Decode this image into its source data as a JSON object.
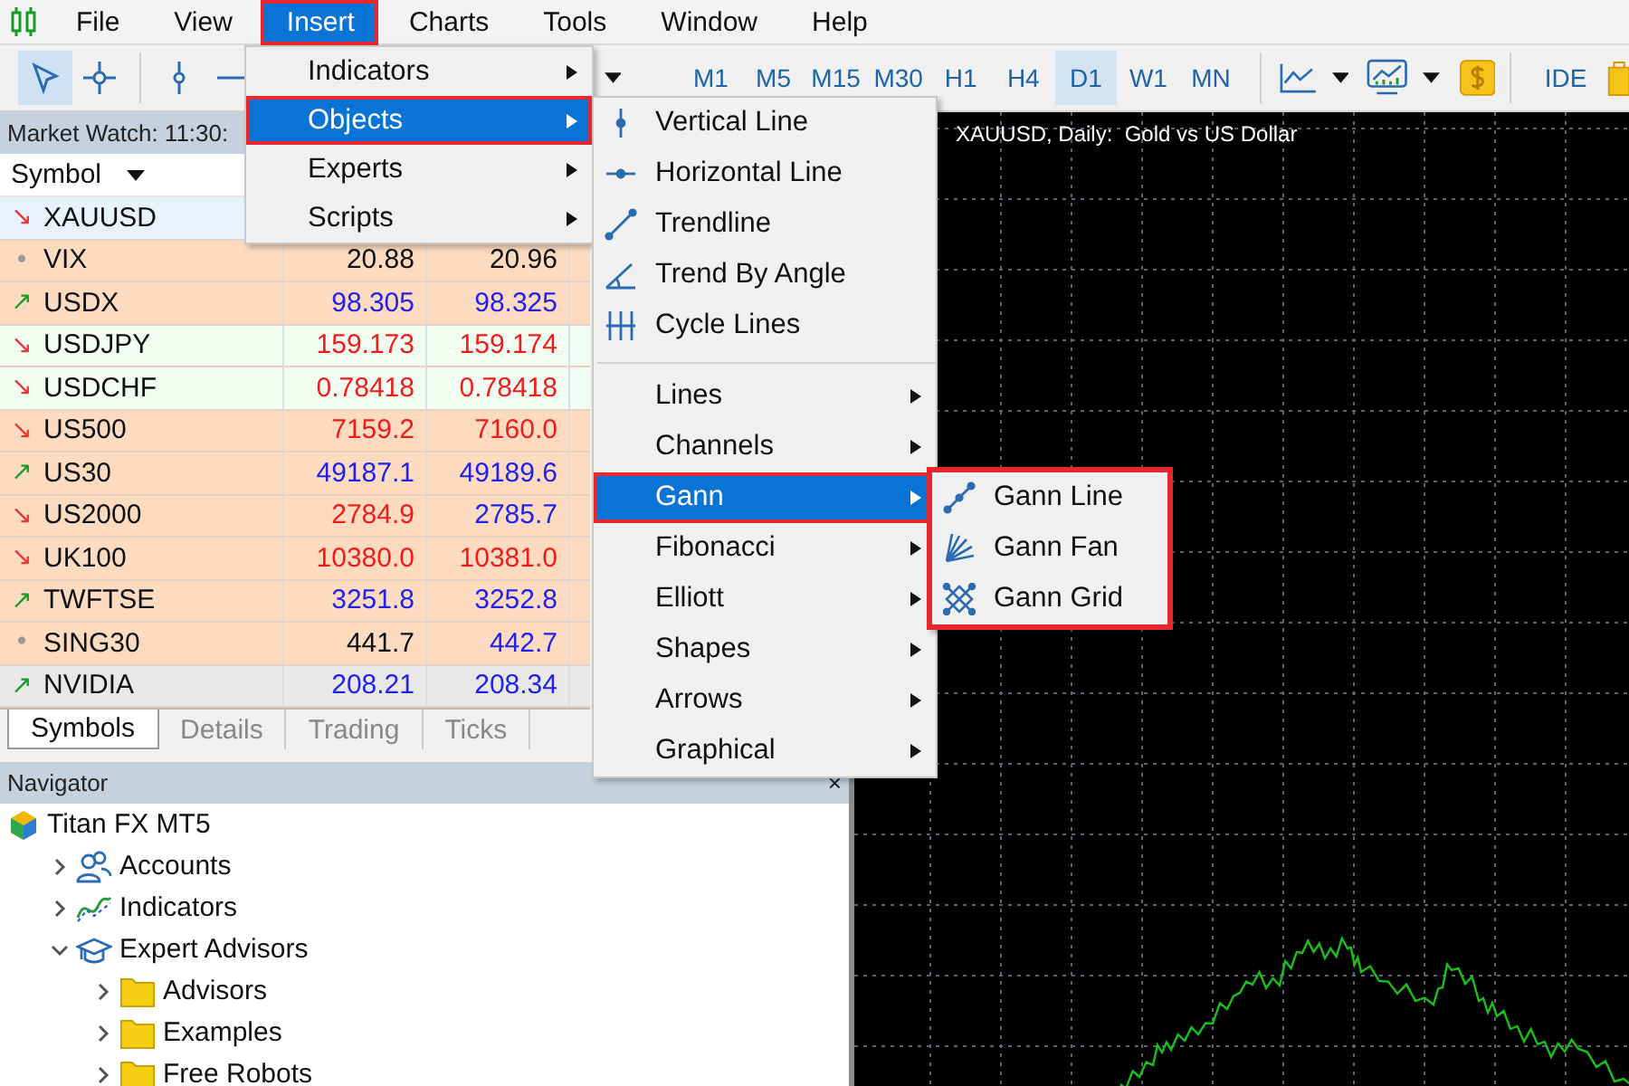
{
  "menu_bar": [
    {
      "label": "File",
      "selected": false,
      "highlighted": false
    },
    {
      "label": "View",
      "selected": false,
      "highlighted": false
    },
    {
      "label": "Insert",
      "selected": true,
      "highlighted": true
    },
    {
      "label": "Charts",
      "selected": false,
      "highlighted": false
    },
    {
      "label": "Tools",
      "selected": false,
      "highlighted": false
    },
    {
      "label": "Window",
      "selected": false,
      "highlighted": false
    },
    {
      "label": "Help",
      "selected": false,
      "highlighted": false
    }
  ],
  "toolbar": {
    "timeframes": [
      {
        "label": "M1",
        "selected": false
      },
      {
        "label": "M5",
        "selected": false
      },
      {
        "label": "M15",
        "selected": false
      },
      {
        "label": "M30",
        "selected": false
      },
      {
        "label": "H1",
        "selected": false
      },
      {
        "label": "H4",
        "selected": false
      },
      {
        "label": "D1",
        "selected": true
      },
      {
        "label": "W1",
        "selected": false
      },
      {
        "label": "MN",
        "selected": false
      }
    ],
    "ide": "IDE"
  },
  "market_watch": {
    "title": "Market Watch: 11:30:",
    "symbol_header": "Symbol",
    "rows": [
      {
        "symbol": "XAUUSD",
        "trend": {
          "glyph": "↘",
          "color": "#e23a3a"
        },
        "color": "#e8f2fc"
      },
      {
        "symbol": "VIX",
        "trend": {
          "glyph": "•",
          "color": "#999999"
        },
        "color": "#fddbc1",
        "bid": {
          "text": "20.88",
          "color": "#111111"
        },
        "ask": {
          "text": "20.96",
          "color": "#111111"
        }
      },
      {
        "symbol": "USDX",
        "trend": {
          "glyph": "↗",
          "color": "#1a9c2a"
        },
        "color": "#fddbc1",
        "bid": {
          "text": "98.305",
          "color": "#2222ee"
        },
        "ask": {
          "text": "98.325",
          "color": "#2222ee"
        }
      },
      {
        "symbol": "USDJPY",
        "trend": {
          "glyph": "↘",
          "color": "#e23a3a"
        },
        "color": "#f0fdf0",
        "bid": {
          "text": "159.173",
          "color": "#f01c1c"
        },
        "ask": {
          "text": "159.174",
          "color": "#f01c1c"
        }
      },
      {
        "symbol": "USDCHF",
        "trend": {
          "glyph": "↘",
          "color": "#e23a3a"
        },
        "color": "#f0fdf0",
        "bid": {
          "text": "0.78418",
          "color": "#f01c1c"
        },
        "ask": {
          "text": "0.78418",
          "color": "#f01c1c"
        }
      },
      {
        "symbol": "US500",
        "trend": {
          "glyph": "↘",
          "color": "#e23a3a"
        },
        "color": "#fddbc1",
        "bid": {
          "text": "7159.2",
          "color": "#f01c1c"
        },
        "ask": {
          "text": "7160.0",
          "color": "#f01c1c"
        }
      },
      {
        "symbol": "US30",
        "trend": {
          "glyph": "↗",
          "color": "#1a9c2a"
        },
        "color": "#fddbc1",
        "bid": {
          "text": "49187.1",
          "color": "#2222ee"
        },
        "ask": {
          "text": "49189.6",
          "color": "#2222ee"
        }
      },
      {
        "symbol": "US2000",
        "trend": {
          "glyph": "↘",
          "color": "#e23a3a"
        },
        "color": "#fddbc1",
        "bid": {
          "text": "2784.9",
          "color": "#f01c1c"
        },
        "ask": {
          "text": "2785.7",
          "color": "#2222ee"
        }
      },
      {
        "symbol": "UK100",
        "trend": {
          "glyph": "↘",
          "color": "#e23a3a"
        },
        "color": "#fddbc1",
        "bid": {
          "text": "10380.0",
          "color": "#f01c1c"
        },
        "ask": {
          "text": "10381.0",
          "color": "#f01c1c"
        }
      },
      {
        "symbol": "TWFTSE",
        "trend": {
          "glyph": "↗",
          "color": "#1a9c2a"
        },
        "color": "#fddbc1",
        "bid": {
          "text": "3251.8",
          "color": "#2222ee"
        },
        "ask": {
          "text": "3252.8",
          "color": "#2222ee"
        }
      },
      {
        "symbol": "SING30",
        "trend": {
          "glyph": "•",
          "color": "#999999"
        },
        "color": "#fddbc1",
        "bid": {
          "text": "441.7",
          "color": "#111111"
        },
        "ask": {
          "text": "442.7",
          "color": "#2222ee"
        }
      },
      {
        "symbol": "NVIDIA",
        "trend": {
          "glyph": "↗",
          "color": "#1a9c2a"
        },
        "color": "#e8e8e8",
        "bid": {
          "text": "208.21",
          "color": "#2222ee"
        },
        "ask": {
          "text": "208.34",
          "color": "#2222ee"
        }
      }
    ],
    "tabs": [
      {
        "label": "Symbols",
        "selected": true
      },
      {
        "label": "Details",
        "selected": false
      },
      {
        "label": "Trading",
        "selected": false
      },
      {
        "label": "Ticks",
        "selected": false
      }
    ]
  },
  "navigator": {
    "title": "Navigator",
    "close": "×",
    "tree": [
      {
        "label": "Titan FX MT5",
        "kind": "broker",
        "children": [
          {
            "label": "Accounts",
            "kind": "accounts",
            "expanded": false
          },
          {
            "label": "Indicators",
            "kind": "indicators",
            "expanded": false
          },
          {
            "label": "Expert Advisors",
            "kind": "experts",
            "expanded": true,
            "children": [
              {
                "label": "Advisors",
                "kind": "folder",
                "expanded": false
              },
              {
                "label": "Examples",
                "kind": "folder",
                "expanded": false
              },
              {
                "label": "Free Robots",
                "kind": "folder",
                "expanded": false
              }
            ]
          }
        ]
      }
    ]
  },
  "chart": {
    "title": "XAUUSD, Daily:  Gold vs US Dollar"
  },
  "insert_menu": {
    "items": [
      {
        "label": "Indicators",
        "selected": false,
        "highlighted": false
      },
      {
        "label": "Objects",
        "selected": true,
        "highlighted": true
      },
      {
        "label": "Experts",
        "selected": false,
        "highlighted": false
      },
      {
        "label": "Scripts",
        "selected": false,
        "highlighted": false
      }
    ]
  },
  "objects_menu": {
    "tools": [
      {
        "label": "Vertical Line",
        "kind": "vline"
      },
      {
        "label": "Horizontal Line",
        "kind": "hline"
      },
      {
        "label": "Trendline",
        "kind": "trend"
      },
      {
        "label": "Trend By Angle",
        "kind": "angle"
      },
      {
        "label": "Cycle Lines",
        "kind": "cycle"
      }
    ],
    "groups": [
      {
        "label": "Lines",
        "selected": false,
        "highlighted": false
      },
      {
        "label": "Channels",
        "selected": false,
        "highlighted": false
      },
      {
        "label": "Gann",
        "selected": true,
        "highlighted": true
      },
      {
        "label": "Fibonacci",
        "selected": false,
        "highlighted": false
      },
      {
        "label": "Elliott",
        "selected": false,
        "highlighted": false
      },
      {
        "label": "Shapes",
        "selected": false,
        "highlighted": false
      },
      {
        "label": "Arrows",
        "selected": false,
        "highlighted": false
      },
      {
        "label": "Graphical",
        "selected": false,
        "highlighted": false
      }
    ]
  },
  "gann_menu": {
    "highlighted": true,
    "items": [
      {
        "label": "Gann Line",
        "kind": "line"
      },
      {
        "label": "Gann Fan",
        "kind": "fan"
      },
      {
        "label": "Gann Grid",
        "kind": "grid"
      }
    ]
  }
}
